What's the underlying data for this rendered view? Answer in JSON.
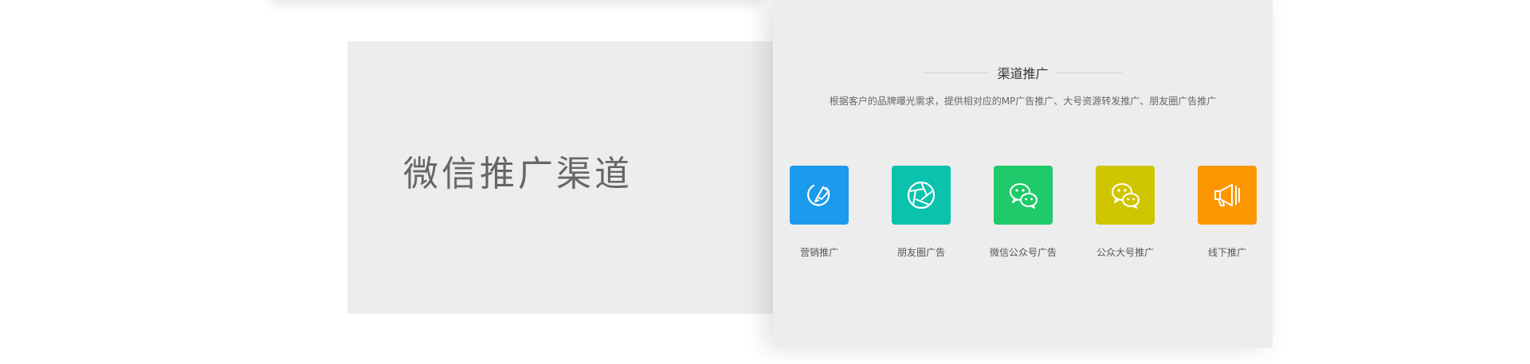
{
  "banner": {
    "title": "微信推广渠道"
  },
  "section": {
    "heading": "渠道推广",
    "subtitle": "根据客户的品牌曝光需求，提供相对应的MP广告推广、大号资源转发推广、朋友圈广告推广"
  },
  "channels": [
    {
      "label": "营销推广",
      "icon": "marketing-pen-icon",
      "color": "#1b9aee"
    },
    {
      "label": "朋友圈广告",
      "icon": "moments-aperture-icon",
      "color": "#0bc2ad"
    },
    {
      "label": "微信公众号广告",
      "icon": "wechat-bubbles-icon",
      "color": "#1fca6a"
    },
    {
      "label": "公众大号推广",
      "icon": "wechat-bubbles-icon",
      "color": "#cfc600"
    },
    {
      "label": "线下推广",
      "icon": "megaphone-icon",
      "color": "#fb9600"
    }
  ]
}
